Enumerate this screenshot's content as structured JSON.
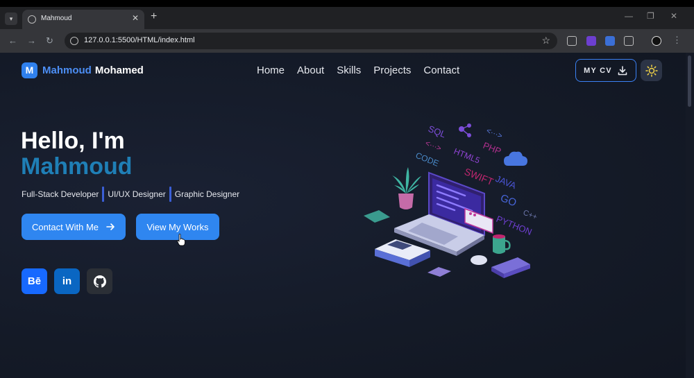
{
  "browser": {
    "tab_title": "Mahmoud",
    "tab_close": "✕",
    "new_tab": "+",
    "url": "127.0.0.1:5500/HTML/index.html",
    "minimize": "—",
    "maximize": "❐",
    "close": "✕"
  },
  "site": {
    "logo_letter": "M",
    "logo_first": "Mahmoud",
    "logo_last": "Mohamed",
    "nav": [
      "Home",
      "About",
      "Skills",
      "Projects",
      "Contact"
    ],
    "cv_label": "MY CV"
  },
  "hero": {
    "greeting": "Hello, I'm",
    "name": "Mahmoud",
    "roles": [
      "Full-Stack Developer",
      "UI/UX Designer",
      "Graphic Designer"
    ],
    "contact_button": "Contact With Me",
    "works_button": "View My Works",
    "social": {
      "behance": "Bē",
      "linkedin": "in"
    },
    "art_labels": [
      "SQL",
      "PHP",
      "HTML5",
      "JAVA",
      "GO",
      "PYTHON",
      "SWIFT",
      "CODE",
      "C++"
    ]
  },
  "colors": {
    "accent": "#2f86f0",
    "name_color": "#1f7fb6",
    "page_bg": "#141a27"
  }
}
